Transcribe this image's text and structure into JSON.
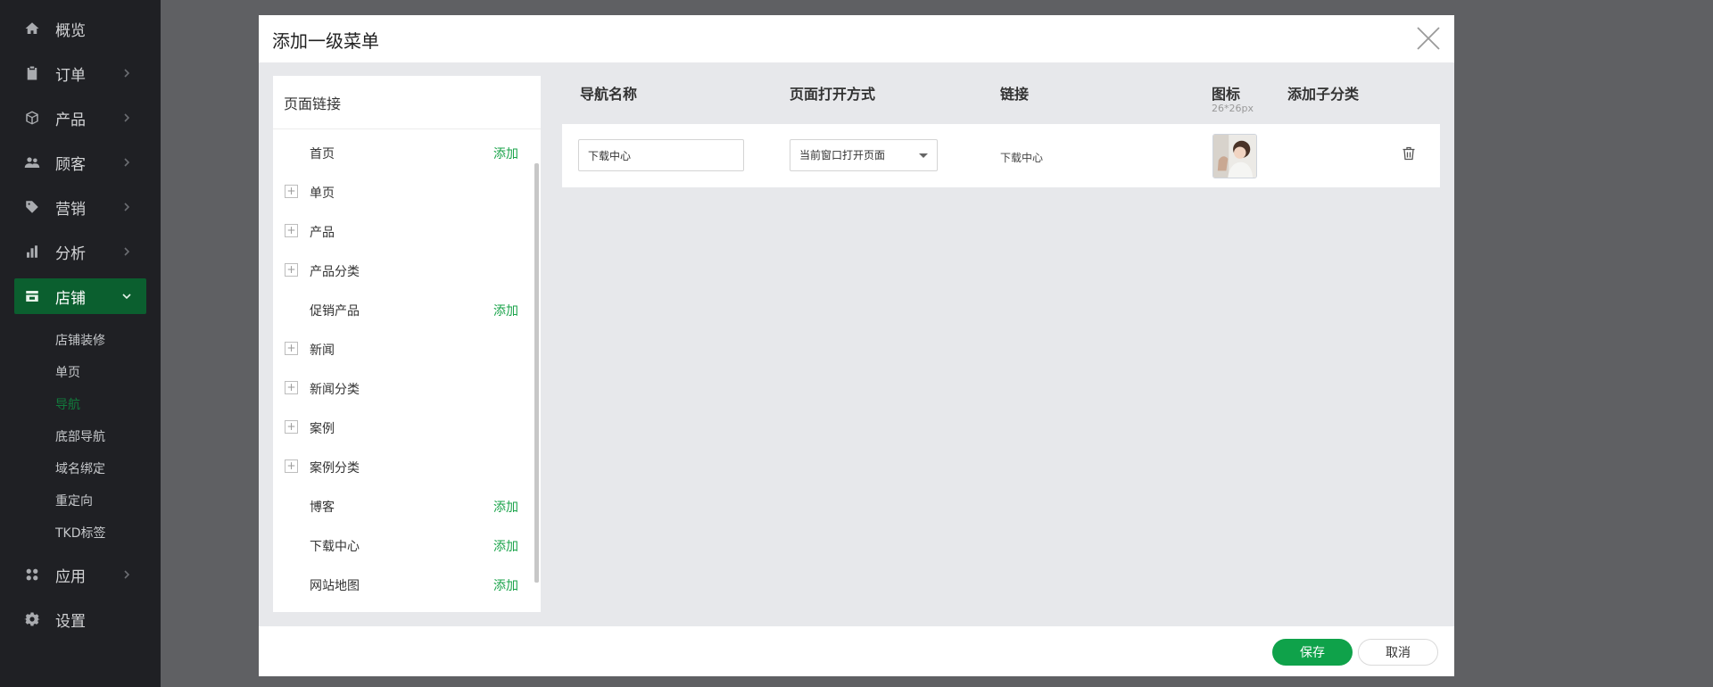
{
  "sidebar": {
    "items": [
      {
        "label": "概览",
        "icon": "home-icon"
      },
      {
        "label": "订单",
        "icon": "clipboard-icon"
      },
      {
        "label": "产品",
        "icon": "box-icon"
      },
      {
        "label": "顾客",
        "icon": "users-icon"
      },
      {
        "label": "营销",
        "icon": "tag-icon"
      },
      {
        "label": "分析",
        "icon": "bar-chart-icon"
      },
      {
        "label": "店铺",
        "icon": "store-icon"
      },
      {
        "label": "应用",
        "icon": "apps-icon"
      },
      {
        "label": "设置",
        "icon": "gear-icon"
      }
    ],
    "store_subitems": [
      "店铺装修",
      "单页",
      "导航",
      "底部导航",
      "域名绑定",
      "重定向",
      "TKD标签"
    ],
    "active_color": "#0b5f2f",
    "current_sub_color": "#127a3c"
  },
  "modal": {
    "title": "添加一级菜单",
    "save_label": "保存",
    "cancel_label": "取消",
    "link_panel": {
      "title": "页面链接",
      "add_label": "添加",
      "items": [
        {
          "label": "首页",
          "expandable": false,
          "addable": true
        },
        {
          "label": "单页",
          "expandable": true,
          "addable": false
        },
        {
          "label": "产品",
          "expandable": true,
          "addable": false
        },
        {
          "label": "产品分类",
          "expandable": true,
          "addable": false
        },
        {
          "label": "促销产品",
          "expandable": false,
          "addable": true
        },
        {
          "label": "新闻",
          "expandable": true,
          "addable": false
        },
        {
          "label": "新闻分类",
          "expandable": true,
          "addable": false
        },
        {
          "label": "案例",
          "expandable": true,
          "addable": false
        },
        {
          "label": "案例分类",
          "expandable": true,
          "addable": false
        },
        {
          "label": "博客",
          "expandable": false,
          "addable": true
        },
        {
          "label": "下载中心",
          "expandable": false,
          "addable": true
        },
        {
          "label": "网站地图",
          "expandable": false,
          "addable": true
        }
      ]
    },
    "table": {
      "headers": {
        "name": "导航名称",
        "open_mode": "页面打开方式",
        "link": "链接",
        "icon": "图标",
        "icon_hint": "26*26px",
        "add_child": "添加子分类"
      },
      "rows": [
        {
          "name": "下载中心",
          "open_mode": "当前窗口打开页面",
          "link": "下载中心"
        }
      ]
    },
    "accent_color": "#0fa24a"
  }
}
